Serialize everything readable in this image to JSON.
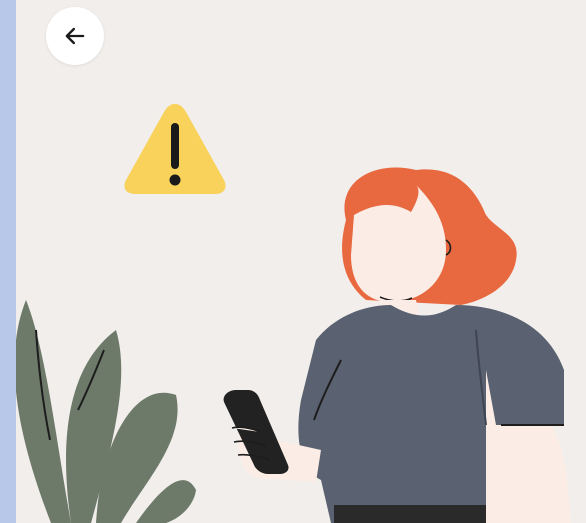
{
  "colors": {
    "background": "#f2eeeb",
    "warning": "#f8d25a",
    "hair": "#e8683f",
    "skin": "#fbede6",
    "shirt": "#5a6170",
    "plant": "#6d7a6a",
    "phone": "#222222"
  },
  "icons": {
    "back": "arrow-left-icon",
    "warning": "warning-triangle-icon"
  }
}
